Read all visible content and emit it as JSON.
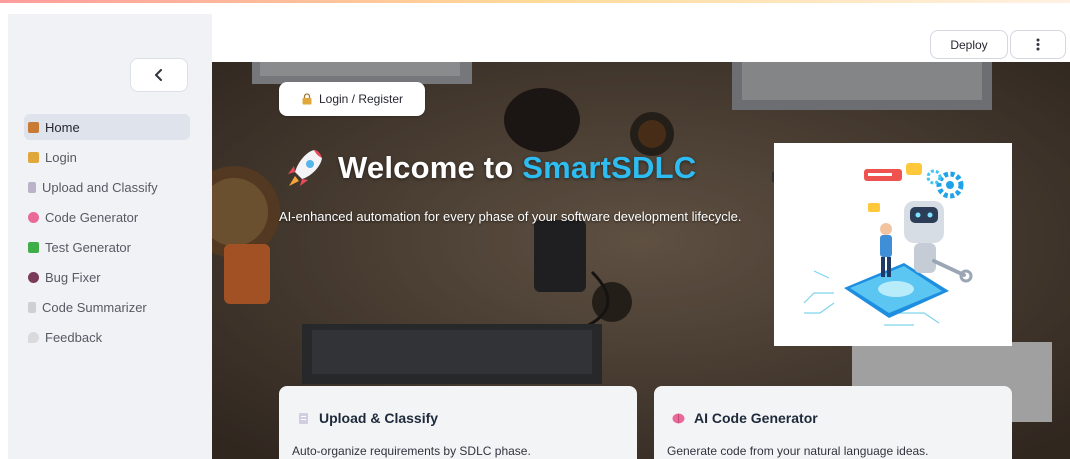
{
  "header": {
    "deploy_label": "Deploy",
    "menu_icon": "vertical-dots-icon"
  },
  "sidebar": {
    "collapse_icon": "chevron-left-icon",
    "items": [
      {
        "label": "Home",
        "icon": "house-icon",
        "color": "#c97a35",
        "active": true
      },
      {
        "label": "Login",
        "icon": "lock-icon",
        "color": "#e0a83a",
        "active": false
      },
      {
        "label": "Upload and Classify",
        "icon": "document-icon",
        "color": "#b9b2c8",
        "active": false
      },
      {
        "label": "Code Generator",
        "icon": "brain-icon",
        "color": "#e96a97",
        "active": false
      },
      {
        "label": "Test Generator",
        "icon": "check-box-icon",
        "color": "#3fae49",
        "active": false
      },
      {
        "label": "Bug Fixer",
        "icon": "bug-icon",
        "color": "#7a3b5a",
        "active": false
      },
      {
        "label": "Code Summarizer",
        "icon": "memo-icon",
        "color": "#cfcfd6",
        "active": false
      },
      {
        "label": "Feedback",
        "icon": "speech-bubble-icon",
        "color": "#d9d9de",
        "active": false
      }
    ]
  },
  "hero": {
    "login_label": "Login / Register",
    "title_prefix": "Welcome to ",
    "title_brand": "SmartSDLC",
    "subtitle": "AI-enhanced automation for every phase of your software development lifecycle.",
    "brand_color": "#2dbdf2"
  },
  "cards": [
    {
      "title": "Upload & Classify",
      "desc": "Auto-organize requirements by SDLC phase.",
      "icon": "document-icon"
    },
    {
      "title": "AI Code Generator",
      "desc": "Generate code from your natural language ideas.",
      "icon": "brain-icon"
    }
  ]
}
